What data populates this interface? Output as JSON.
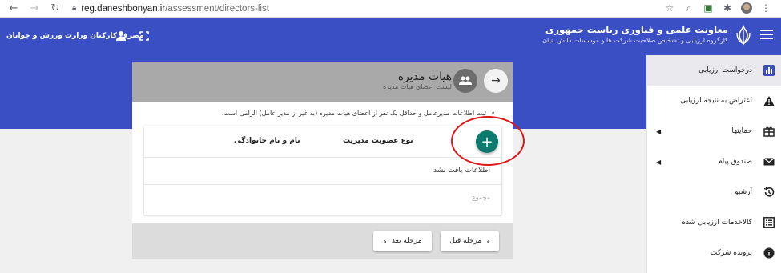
{
  "browser": {
    "url_domain": "reg.daneshbonyan.ir",
    "url_path": "/assessment/directors-list"
  },
  "header": {
    "org_title": "معاونت علمی و فناوری ریاست جمهوری",
    "org_subtitle": "کارگروه ارزیابی و تشخیص صلاحیت شرکت ها و موسسات دانش بنیان",
    "user_label": "مصرف کارکنان وزارت ورزش و جوانان"
  },
  "sidebar": {
    "items": [
      {
        "label": "درخواست ارزیابی",
        "icon": "bar-chart-icon",
        "active": true
      },
      {
        "label": "اعتراض به نتیجه ارزیابی",
        "icon": "warning-icon"
      },
      {
        "label": "حمایتها",
        "icon": "gift-icon",
        "expandable": true
      },
      {
        "label": "صندوق پیام",
        "icon": "mail-icon",
        "expandable": true
      },
      {
        "label": "آرشیو",
        "icon": "history-icon"
      },
      {
        "label": "کالاخدمات ارزیابی شده",
        "icon": "list-icon"
      },
      {
        "label": "پرونده شرکت",
        "icon": "info-icon"
      }
    ]
  },
  "card": {
    "title": "هیات مدیره",
    "subtitle": "لیست اعضای هیات مدیره",
    "notice": "ثبت اطلاعات مدیرعامل و حداقل یک نفر از اعضای هیات مدیره (به غیر از مدیر عامل) الزامی است.",
    "table": {
      "columns": [
        "نوع عضویت مدیریت",
        "نام و نام خانوادگی"
      ],
      "empty_text": "اطلاعات یافت نشد",
      "total_label": "مجموع"
    },
    "buttons": {
      "prev": "مرحله قبل",
      "next": "مرحله بعد"
    }
  },
  "colors": {
    "header_blue": "#3b4fc4",
    "add_button": "#0e7a6e",
    "highlight": "#e01515"
  }
}
